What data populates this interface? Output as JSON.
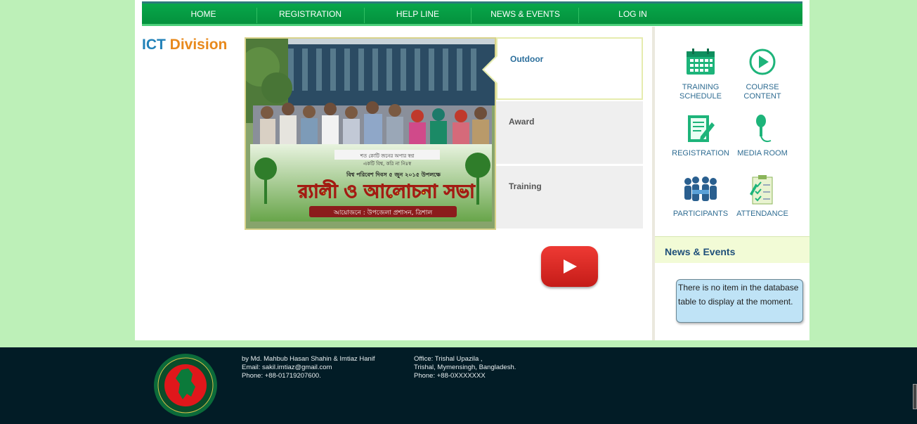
{
  "nav": {
    "items": [
      "HOME",
      "REGISTRATION",
      "HELP LINE",
      "NEWS & EVENTS",
      "LOG IN"
    ]
  },
  "brand": {
    "part1": "ICT",
    "part2": "Division"
  },
  "slider": {
    "tabs": [
      "Outdoor",
      "Award",
      "Training"
    ],
    "active_tab": "Outdoor",
    "banner_text": {
      "line1": "শত কোটি জনের অপার স্বপ্ন",
      "line2": "একটি বিশ্ব, করি না নিঃস্ব",
      "line3": "বিশ্ব পরিবেশ দিবস ৫ জুন ২০১৫ উপলক্ষে",
      "headline": "র‌্যালী ও আলোচনা সভা",
      "organizer": "আয়োজনে : উপজেলা প্রশাসন, ত্রিশাল"
    }
  },
  "quicklinks": [
    {
      "label1": "TRAINING",
      "label2": "SCHEDULE",
      "icon": "calendar-icon"
    },
    {
      "label1": "COURSE",
      "label2": "CONTENT",
      "icon": "play-icon"
    },
    {
      "label1": "REGISTRATION",
      "label2": "",
      "icon": "form-pencil-icon"
    },
    {
      "label1": "MEDIA ROOM",
      "label2": "",
      "icon": "microphone-icon"
    },
    {
      "label1": "PARTICIPANTS",
      "label2": "",
      "icon": "people-icon"
    },
    {
      "label1": "ATTENDANCE",
      "label2": "",
      "icon": "checklist-icon"
    }
  ],
  "news": {
    "heading": "News & Events",
    "empty_message": "There is no item in the database table to display at the moment."
  },
  "footer": {
    "credit": "by Md. Mahbub Hasan Shahin & Imtiaz Hanif",
    "email": "Email: sakil.imtiaz@gmail.com",
    "phone": "Phone: +88-01719207600.",
    "office_line1": "Office: Trishal Upazila ,",
    "office_line2": "Trishal, Mymensingh, Bangladesh.",
    "office_phone": "Phone: +88-0XXXXXXX"
  },
  "colors": {
    "nav_green": "#04913d",
    "page_bg": "#bdf0b8",
    "footer_bg": "#021c26",
    "brand_blue": "#2181b8",
    "brand_orange": "#e8891c",
    "youtube_red": "#d8231f",
    "tile_green": "#17b77a"
  }
}
